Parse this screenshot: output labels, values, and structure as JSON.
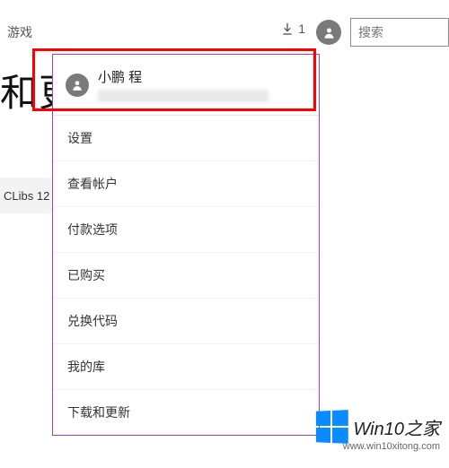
{
  "topbar": {
    "nav_label": "游戏",
    "download_count": "1",
    "search_placeholder": "搜索"
  },
  "page_title_fragment": "和更",
  "row_fragment": "CLibs 12",
  "menu": {
    "user": {
      "name": "小鹏 程",
      "email_redacted": true
    },
    "items": [
      {
        "label": "设置"
      },
      {
        "label": "查看帐户"
      },
      {
        "label": "付款选项"
      },
      {
        "label": "已购买"
      },
      {
        "label": "兑换代码"
      },
      {
        "label": "我的库"
      },
      {
        "label": "下载和更新"
      }
    ]
  },
  "watermark": {
    "brand": "Win10之家",
    "url": "www.win10xitong.com"
  },
  "colors": {
    "menu_border": "#a040c8",
    "highlight": "#f00",
    "win_logo": "#0a8cff"
  }
}
